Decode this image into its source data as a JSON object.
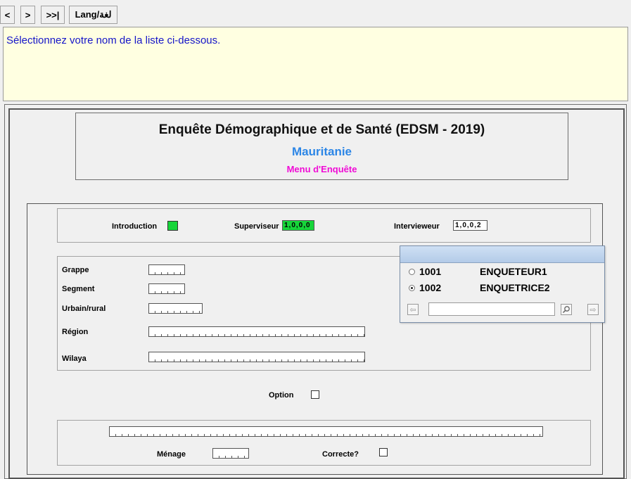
{
  "toolbar": {
    "prev": "<",
    "next": ">",
    "last": ">>|",
    "lang": "Lang/لغة"
  },
  "message": "Sélectionnez votre nom de la liste ci-dessous.",
  "header": {
    "title": "Enquête Démographique et de Santé (EDSM - 2019)",
    "country": "Mauritanie",
    "menu": "Menu d'Enquête"
  },
  "top_row": {
    "introduction": "Introduction",
    "superviseur": "Superviseur",
    "superviseur_value": "1,0,0,0",
    "intervieweur": "Intervieweur",
    "intervieweur_value": "1,0,0,2"
  },
  "fields": {
    "grappe": "Grappe",
    "segment": "Segment",
    "urbain_rural": "Urbain/rural",
    "region": "Région",
    "wilaya": "Wilaya",
    "option": "Option",
    "menage": "Ménage",
    "correcte": "Correcte?"
  },
  "popup": {
    "items": [
      {
        "code": "1001",
        "name": "ENQUETEUR1",
        "selected": false
      },
      {
        "code": "1002",
        "name": "ENQUETRICE2",
        "selected": true
      }
    ],
    "search_value": ""
  },
  "colors": {
    "introduction_indicator": "#17d53a",
    "superviseur_value_bg": "#17d53a",
    "message_bg": "#ffffe1",
    "message_text": "#1515c8",
    "country_text": "#2c86e6",
    "menu_text": "#f00cd6"
  },
  "icons": {
    "prev": "left-arrow-icon",
    "search": "magnifier-icon",
    "next": "right-arrow-icon"
  }
}
